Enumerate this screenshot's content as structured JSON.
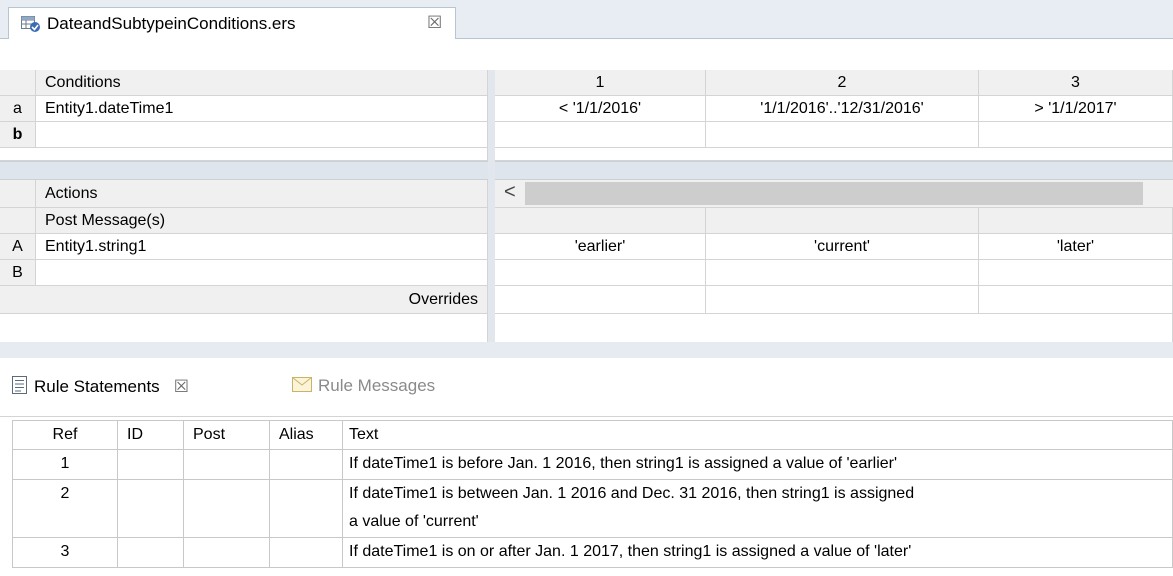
{
  "editor": {
    "tab_title": "DateandSubtypeinConditions.ers",
    "tab_close": "☒"
  },
  "conditions": {
    "header": "Conditions",
    "columns": [
      "1",
      "2",
      "3"
    ],
    "rows": [
      {
        "key": "a",
        "expr": "Entity1.dateTime1",
        "values": [
          "< '1/1/2016'",
          "'1/1/2016'..'12/31/2016'",
          "> '1/1/2017'"
        ]
      },
      {
        "key": "b",
        "expr": "",
        "values": [
          "",
          "",
          ""
        ]
      }
    ]
  },
  "actions": {
    "header": "Actions",
    "post_header": "Post Message(s)",
    "scroll_left": "<",
    "rows": [
      {
        "key": "A",
        "expr": "Entity1.string1",
        "values": [
          "'earlier'",
          "'current'",
          "'later'"
        ]
      },
      {
        "key": "B",
        "expr": "",
        "values": [
          "",
          "",
          ""
        ]
      }
    ],
    "overrides_label": "Overrides"
  },
  "views": {
    "rule_statements_label": "Rule Statements",
    "rule_statements_close": "☒",
    "rule_messages_label": "Rule Messages",
    "icons": {
      "rule_statements": "document-icon",
      "rule_messages": "envelope-icon",
      "editor": "ruleset-icon"
    }
  },
  "rule_statements": {
    "columns": [
      "Ref",
      "ID",
      "Post",
      "Alias",
      "Text"
    ],
    "rows": [
      {
        "ref": "1",
        "id": "",
        "post": "",
        "alias": "",
        "text": [
          "If dateTime1 is before Jan. 1 2016, then string1 is assigned a value of 'earlier'"
        ]
      },
      {
        "ref": "2",
        "id": "",
        "post": "",
        "alias": "",
        "text": [
          "If dateTime1 is between Jan. 1 2016 and Dec. 31 2016, then string1 is assigned",
          "a value of 'current'"
        ]
      },
      {
        "ref": "3",
        "id": "",
        "post": "",
        "alias": "",
        "text": [
          "If dateTime1 is on or after Jan. 1 2017, then string1 is assigned a value of 'later'"
        ]
      }
    ]
  }
}
